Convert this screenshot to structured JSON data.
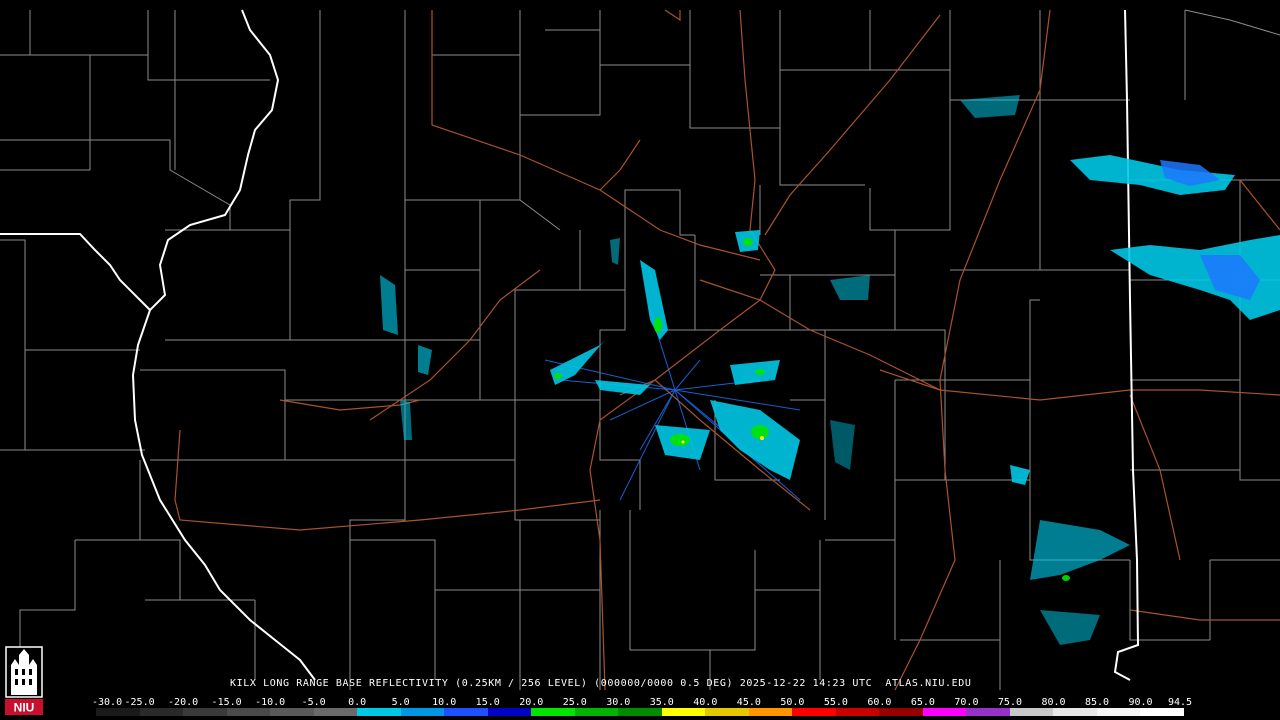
{
  "product": {
    "caption": "KILX LONG RANGE BASE REFLECTIVITY (0.25KM / 256 LEVEL) (000000/0000 0.5 DEG) 2025-12-22 14:23 UTC  ATLAS.NIU.EDU"
  },
  "logo": {
    "text": "NIU",
    "color": "#c8102e"
  },
  "colorbar": {
    "ticks": [
      "-30.0",
      "-25.0",
      "-20.0",
      "-15.0",
      "-10.0",
      "-5.0",
      "0.0",
      "5.0",
      "10.0",
      "15.0",
      "20.0",
      "25.0",
      "30.0",
      "35.0",
      "40.0",
      "45.0",
      "50.0",
      "55.0",
      "60.0",
      "65.0",
      "70.0",
      "75.0",
      "80.0",
      "85.0",
      "90.0",
      "94.5"
    ],
    "colors": [
      "#1a1a1a",
      "#2a2a2a",
      "#3a3a3a",
      "#4a4a4a",
      "#5a5a5a",
      "#6a6a6a",
      "#00c8e6",
      "#0096e6",
      "#1e50ff",
      "#0000c8",
      "#00e600",
      "#00b400",
      "#008c00",
      "#ffff00",
      "#e6c800",
      "#ff9600",
      "#ff0000",
      "#c80000",
      "#960000",
      "#ff00ff",
      "#9632c8",
      "#c8c8c8",
      "#e6e6e6",
      "#f5f5f5",
      "#ffffff"
    ]
  },
  "map_colors": {
    "county_border": "#9a9a9a",
    "state_border": "#ffffff",
    "highway": "#b05a32",
    "echo_light": "#1e78ff",
    "echo_mid": "#00c8e6",
    "echo_strong": "#00e600"
  }
}
